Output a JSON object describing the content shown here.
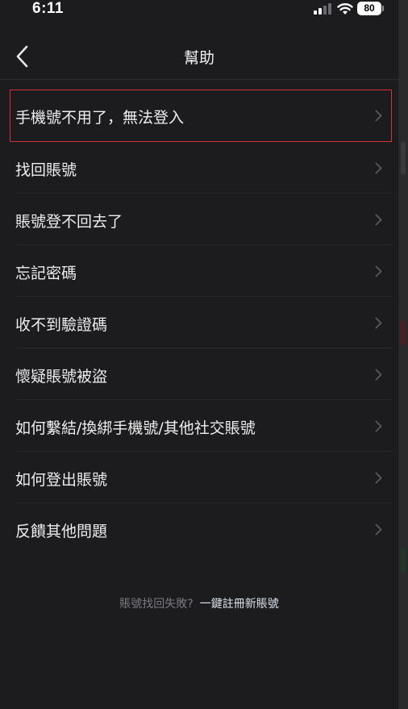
{
  "status_bar": {
    "time": "6:11",
    "battery": "80",
    "icons": [
      "signal-icon",
      "wifi-icon",
      "battery-icon"
    ]
  },
  "nav": {
    "title": "幫助",
    "back_icon": "chevron-left-icon"
  },
  "menu": {
    "items": [
      {
        "label": "手機號不用了，無法登入",
        "highlighted": true
      },
      {
        "label": "找回賬號"
      },
      {
        "label": "賬號登不回去了"
      },
      {
        "label": "忘記密碼"
      },
      {
        "label": "收不到驗證碼"
      },
      {
        "label": "懷疑賬號被盜"
      },
      {
        "label": "如何繫結/換綁手機號/其他社交賬號"
      },
      {
        "label": "如何登出賬號"
      },
      {
        "label": "反饋其他問題"
      }
    ],
    "item_icon": "chevron-right-icon"
  },
  "footer": {
    "question": "賬號找回失敗?",
    "link": "一鍵註冊新賬號"
  },
  "colors": {
    "background": "#1c1c1e",
    "highlight_border": "#d2333a",
    "text": "#ededed",
    "muted_text": "#7b7b80",
    "chevron": "#5a5a5e"
  }
}
